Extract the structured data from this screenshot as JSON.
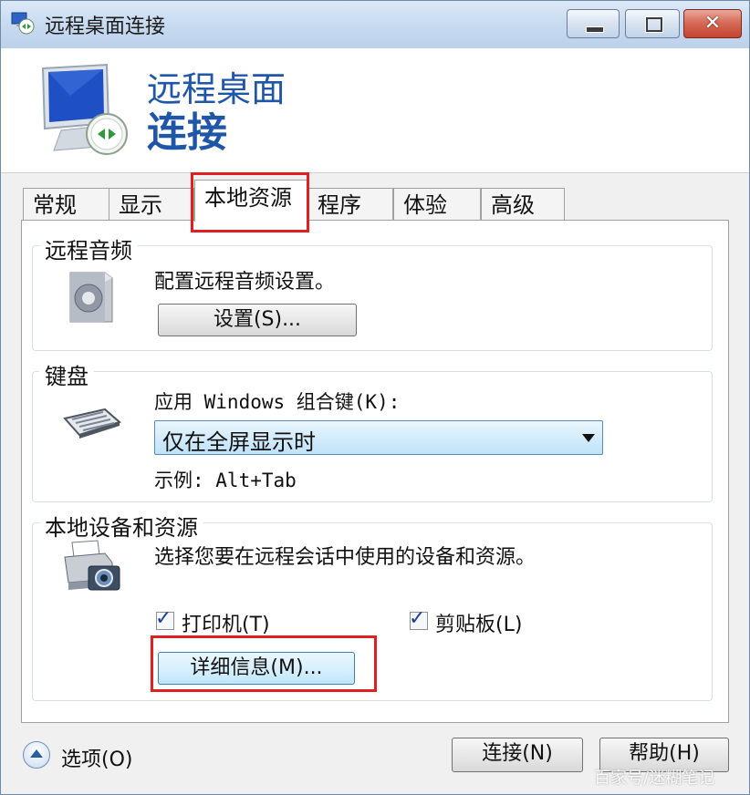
{
  "window": {
    "title": "远程桌面连接"
  },
  "header": {
    "line1": "远程桌面",
    "line2": "连接"
  },
  "tabs": [
    {
      "label": "常规",
      "selected": false
    },
    {
      "label": "显示",
      "selected": false
    },
    {
      "label": "本地资源",
      "selected": true
    },
    {
      "label": "程序",
      "selected": false
    },
    {
      "label": "体验",
      "selected": false
    },
    {
      "label": "高级",
      "selected": false
    }
  ],
  "remote_audio": {
    "title": "远程音频",
    "description": "配置远程音频设置。",
    "settings_button": "设置(S)..."
  },
  "keyboard": {
    "title": "键盘",
    "label": "应用 Windows 组合键(K):",
    "selected_option": "仅在全屏显示时",
    "example": "示例: Alt+Tab"
  },
  "local_devices": {
    "title": "本地设备和资源",
    "description": "选择您要在远程会话中使用的设备和资源。",
    "printer_label": "打印机(T)",
    "printer_checked": true,
    "clipboard_label": "剪贴板(L)",
    "clipboard_checked": true,
    "details_button": "详细信息(M)..."
  },
  "footer": {
    "options_label": "选项(O)",
    "connect_button": "连接(N)",
    "help_button": "帮助(H)"
  },
  "watermark": "百家号/迷糊笔记",
  "colors": {
    "header_text": "#1f56a7",
    "highlight": "#e02020"
  },
  "icons": {
    "title": "remote-desktop-icon",
    "header": "monitor-connect-icon",
    "audio": "speaker-icon",
    "keyboard": "keyboard-icon",
    "devices": "printer-camera-icon",
    "expander": "chevron-up-icon"
  }
}
